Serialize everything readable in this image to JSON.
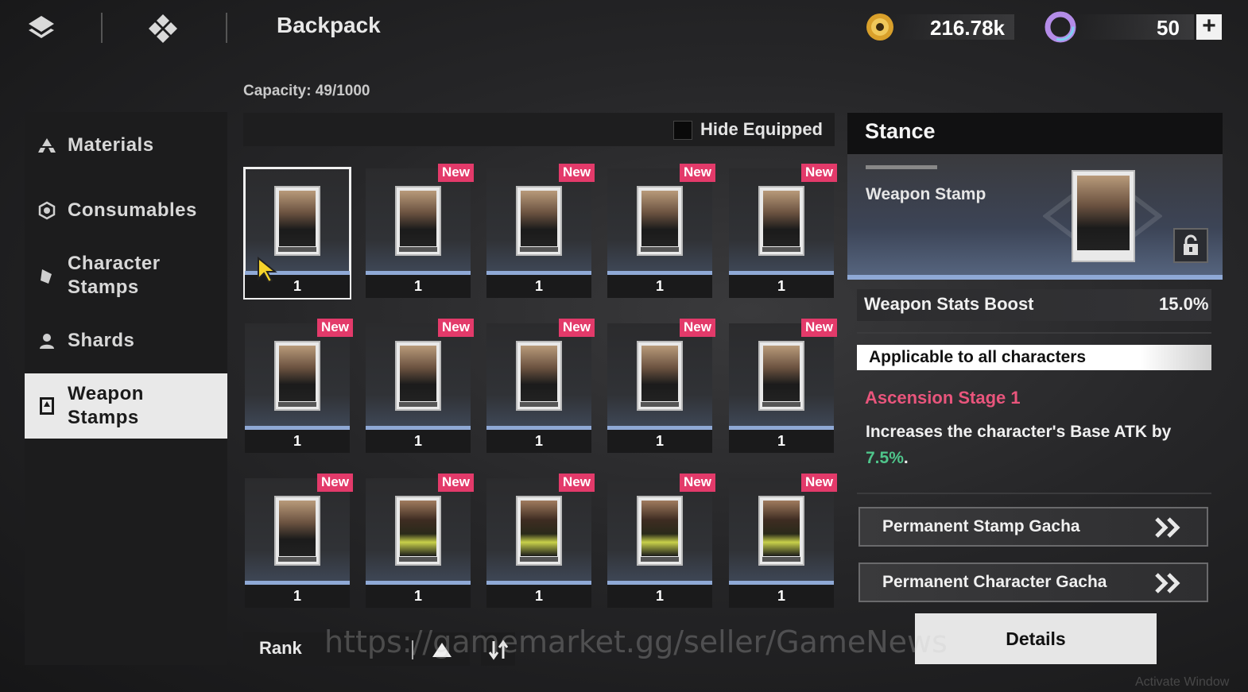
{
  "header": {
    "title": "Backpack",
    "currency_gold": "216.78k",
    "currency_premium": "50",
    "plus_label": "+"
  },
  "capacity": "Capacity: 49/1000",
  "sidebar": {
    "items": [
      {
        "label": "Materials",
        "icon": "materials-icon"
      },
      {
        "label": "Consumables",
        "icon": "consumables-icon"
      },
      {
        "label": "Character Stamps",
        "icon": "character-stamps-icon"
      },
      {
        "label": "Shards",
        "icon": "shards-icon"
      },
      {
        "label": "Weapon Stamps",
        "icon": "weapon-stamps-icon",
        "active": true
      }
    ]
  },
  "filter": {
    "hide_equipped_label": "Hide Equipped",
    "hide_equipped_checked": false
  },
  "grid": {
    "new_label": "New",
    "items": [
      {
        "qty": "1",
        "new": false,
        "selected": true
      },
      {
        "qty": "1",
        "new": true
      },
      {
        "qty": "1",
        "new": true
      },
      {
        "qty": "1",
        "new": true
      },
      {
        "qty": "1",
        "new": true
      },
      {
        "qty": "1",
        "new": true
      },
      {
        "qty": "1",
        "new": true
      },
      {
        "qty": "1",
        "new": true
      },
      {
        "qty": "1",
        "new": true
      },
      {
        "qty": "1",
        "new": true
      },
      {
        "qty": "1",
        "new": true
      },
      {
        "qty": "1",
        "new": true
      },
      {
        "qty": "1",
        "new": true
      },
      {
        "qty": "1",
        "new": true
      },
      {
        "qty": "1",
        "new": true
      }
    ]
  },
  "sort": {
    "label": "Rank",
    "direction": "ascending"
  },
  "detail": {
    "name": "Stance",
    "type": "Weapon Stamp",
    "stat_name": "Weapon Stats Boost",
    "stat_value": "15.0%",
    "applicable": "Applicable to all characters",
    "ascension": "Ascension Stage 1",
    "desc_text": "Increases the character's Base ATK by",
    "desc_value": "7.5%",
    "desc_end": ".",
    "gacha_1": "Permanent Stamp Gacha",
    "gacha_2": "Permanent Character Gacha",
    "details_button": "Details"
  },
  "overlay": {
    "watermark": "https://gamemarket.gg/seller/GameNews",
    "activate": "Activate Window"
  },
  "colors": {
    "accent_pink": "#e33a6a",
    "accent_green": "#4fc58b",
    "accent_blue": "#8fa9d6"
  }
}
